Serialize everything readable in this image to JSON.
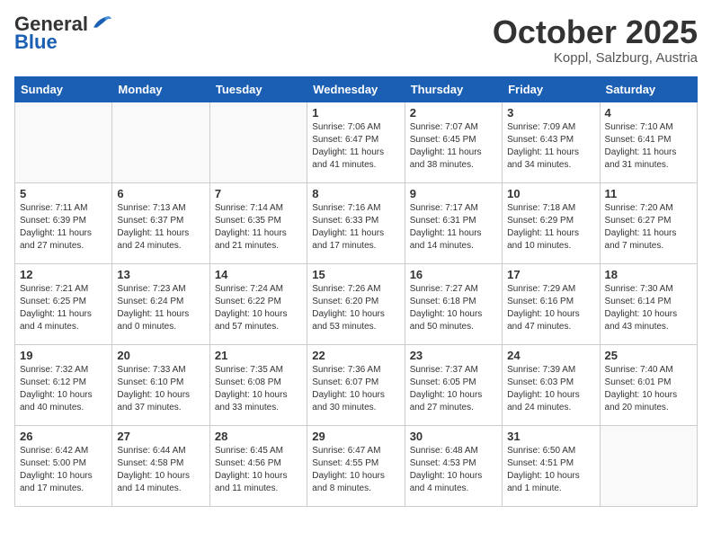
{
  "header": {
    "logo_general": "General",
    "logo_blue": "Blue",
    "month_title": "October 2025",
    "location": "Koppl, Salzburg, Austria"
  },
  "days_of_week": [
    "Sunday",
    "Monday",
    "Tuesday",
    "Wednesday",
    "Thursday",
    "Friday",
    "Saturday"
  ],
  "weeks": [
    [
      {
        "day": "",
        "info": ""
      },
      {
        "day": "",
        "info": ""
      },
      {
        "day": "",
        "info": ""
      },
      {
        "day": "1",
        "info": "Sunrise: 7:06 AM\nSunset: 6:47 PM\nDaylight: 11 hours\nand 41 minutes."
      },
      {
        "day": "2",
        "info": "Sunrise: 7:07 AM\nSunset: 6:45 PM\nDaylight: 11 hours\nand 38 minutes."
      },
      {
        "day": "3",
        "info": "Sunrise: 7:09 AM\nSunset: 6:43 PM\nDaylight: 11 hours\nand 34 minutes."
      },
      {
        "day": "4",
        "info": "Sunrise: 7:10 AM\nSunset: 6:41 PM\nDaylight: 11 hours\nand 31 minutes."
      }
    ],
    [
      {
        "day": "5",
        "info": "Sunrise: 7:11 AM\nSunset: 6:39 PM\nDaylight: 11 hours\nand 27 minutes."
      },
      {
        "day": "6",
        "info": "Sunrise: 7:13 AM\nSunset: 6:37 PM\nDaylight: 11 hours\nand 24 minutes."
      },
      {
        "day": "7",
        "info": "Sunrise: 7:14 AM\nSunset: 6:35 PM\nDaylight: 11 hours\nand 21 minutes."
      },
      {
        "day": "8",
        "info": "Sunrise: 7:16 AM\nSunset: 6:33 PM\nDaylight: 11 hours\nand 17 minutes."
      },
      {
        "day": "9",
        "info": "Sunrise: 7:17 AM\nSunset: 6:31 PM\nDaylight: 11 hours\nand 14 minutes."
      },
      {
        "day": "10",
        "info": "Sunrise: 7:18 AM\nSunset: 6:29 PM\nDaylight: 11 hours\nand 10 minutes."
      },
      {
        "day": "11",
        "info": "Sunrise: 7:20 AM\nSunset: 6:27 PM\nDaylight: 11 hours\nand 7 minutes."
      }
    ],
    [
      {
        "day": "12",
        "info": "Sunrise: 7:21 AM\nSunset: 6:25 PM\nDaylight: 11 hours\nand 4 minutes."
      },
      {
        "day": "13",
        "info": "Sunrise: 7:23 AM\nSunset: 6:24 PM\nDaylight: 11 hours\nand 0 minutes."
      },
      {
        "day": "14",
        "info": "Sunrise: 7:24 AM\nSunset: 6:22 PM\nDaylight: 10 hours\nand 57 minutes."
      },
      {
        "day": "15",
        "info": "Sunrise: 7:26 AM\nSunset: 6:20 PM\nDaylight: 10 hours\nand 53 minutes."
      },
      {
        "day": "16",
        "info": "Sunrise: 7:27 AM\nSunset: 6:18 PM\nDaylight: 10 hours\nand 50 minutes."
      },
      {
        "day": "17",
        "info": "Sunrise: 7:29 AM\nSunset: 6:16 PM\nDaylight: 10 hours\nand 47 minutes."
      },
      {
        "day": "18",
        "info": "Sunrise: 7:30 AM\nSunset: 6:14 PM\nDaylight: 10 hours\nand 43 minutes."
      }
    ],
    [
      {
        "day": "19",
        "info": "Sunrise: 7:32 AM\nSunset: 6:12 PM\nDaylight: 10 hours\nand 40 minutes."
      },
      {
        "day": "20",
        "info": "Sunrise: 7:33 AM\nSunset: 6:10 PM\nDaylight: 10 hours\nand 37 minutes."
      },
      {
        "day": "21",
        "info": "Sunrise: 7:35 AM\nSunset: 6:08 PM\nDaylight: 10 hours\nand 33 minutes."
      },
      {
        "day": "22",
        "info": "Sunrise: 7:36 AM\nSunset: 6:07 PM\nDaylight: 10 hours\nand 30 minutes."
      },
      {
        "day": "23",
        "info": "Sunrise: 7:37 AM\nSunset: 6:05 PM\nDaylight: 10 hours\nand 27 minutes."
      },
      {
        "day": "24",
        "info": "Sunrise: 7:39 AM\nSunset: 6:03 PM\nDaylight: 10 hours\nand 24 minutes."
      },
      {
        "day": "25",
        "info": "Sunrise: 7:40 AM\nSunset: 6:01 PM\nDaylight: 10 hours\nand 20 minutes."
      }
    ],
    [
      {
        "day": "26",
        "info": "Sunrise: 6:42 AM\nSunset: 5:00 PM\nDaylight: 10 hours\nand 17 minutes."
      },
      {
        "day": "27",
        "info": "Sunrise: 6:44 AM\nSunset: 4:58 PM\nDaylight: 10 hours\nand 14 minutes."
      },
      {
        "day": "28",
        "info": "Sunrise: 6:45 AM\nSunset: 4:56 PM\nDaylight: 10 hours\nand 11 minutes."
      },
      {
        "day": "29",
        "info": "Sunrise: 6:47 AM\nSunset: 4:55 PM\nDaylight: 10 hours\nand 8 minutes."
      },
      {
        "day": "30",
        "info": "Sunrise: 6:48 AM\nSunset: 4:53 PM\nDaylight: 10 hours\nand 4 minutes."
      },
      {
        "day": "31",
        "info": "Sunrise: 6:50 AM\nSunset: 4:51 PM\nDaylight: 10 hours\nand 1 minute."
      },
      {
        "day": "",
        "info": ""
      }
    ]
  ]
}
